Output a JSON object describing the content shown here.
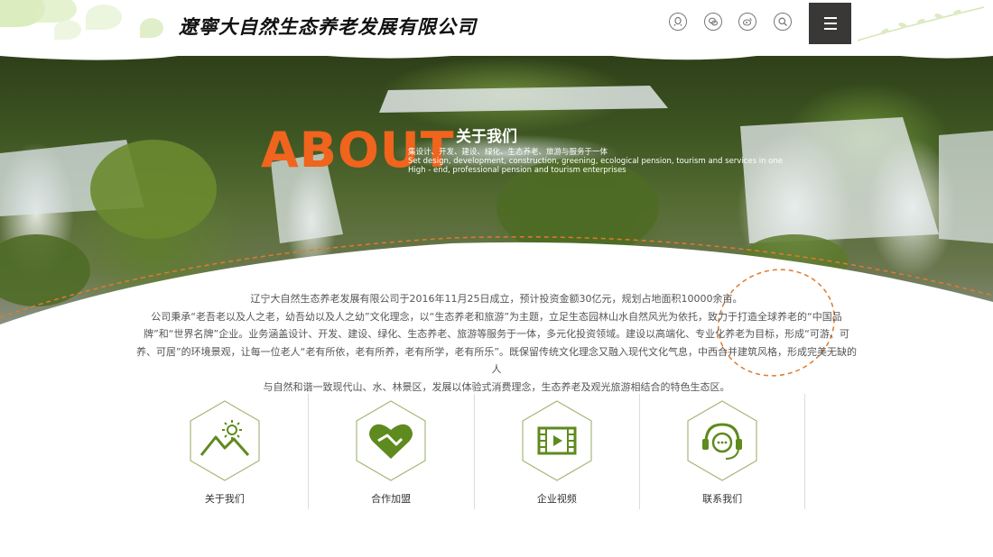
{
  "header": {
    "company_name": "遼寧大自然生态养老发展有限公司",
    "social_icons": [
      "qq-icon",
      "wechat-icon",
      "weibo-icon",
      "search-icon"
    ],
    "menu_icon": "hamburger-menu-icon"
  },
  "hero": {
    "about_word": "ABOUT",
    "title_cn": "关于我们",
    "subtitle_cn": "集设计、开发、建设、绿化、生态养老、旅游与服务于一体",
    "subtitle_en_1": "Set design, development, construction, greening, ecological pension, tourism and services in one",
    "subtitle_en_2": "High - end, professional pension and tourism enterprises"
  },
  "intro": {
    "line1": "辽宁大自然生态养老发展有限公司于2016年11月25日成立，预计投资金额30亿元，规划占地面积10000余亩。",
    "line2": "公司秉承“老吾老以及人之老，幼吾幼以及人之幼”文化理念，以“生态养老和旅游”为主题，立足生态园林山水自然风光为依托，致力于打造全球养老的“中国品",
    "line3": "牌”和“世界名牌”企业。业务涵盖设计、开发、建设、绿化、生态养老、旅游等服务于一体，多元化投资领域。建设以高端化、专业化养老为目标，形成“可游、可",
    "line4": "养、可居”的环境景观，让每一位老人“老有所依，老有所养，老有所学，老有所乐”。既保留传统文化理念又融入现代文化气息，中西合并建筑风格，形成完美无缺的人",
    "line5": "与自然和谐一致现代山、水、林景区，发展以体验式消费理念，生态养老及观光旅游相结合的特色生态区。"
  },
  "features": [
    {
      "label": "关于我们",
      "icon": "mountain-sun-icon"
    },
    {
      "label": "合作加盟",
      "icon": "heart-handshake-icon"
    },
    {
      "label": "企业视频",
      "icon": "film-play-icon"
    },
    {
      "label": "联系我们",
      "icon": "headset-chat-icon"
    }
  ],
  "colors": {
    "accent_orange": "#f0641e",
    "icon_green": "#5f8a1e",
    "menu_bg": "#3a3837"
  }
}
